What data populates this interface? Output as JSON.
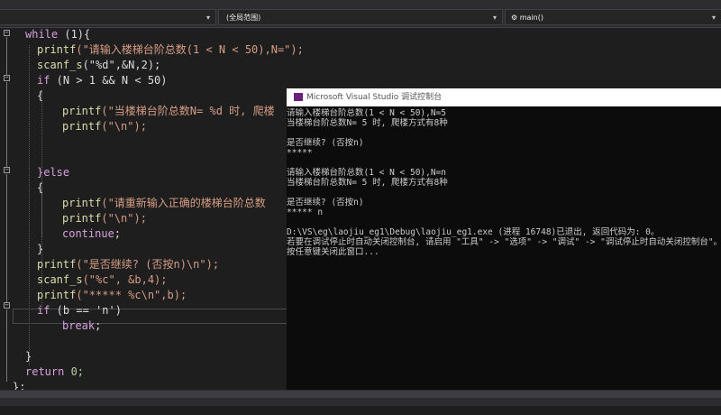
{
  "toolbar": {
    "scope_dropdown": "(全局范围)",
    "function_dropdown": "main()",
    "function_icon": "gear-icon"
  },
  "code_lines": [
    [
      "while",
      " (1){"
    ],
    [
      "printf",
      "(\"请输入楼梯台阶总数(1 < N < 50),N=\");"
    ],
    [
      "scanf_s",
      "(\"%d\",&N,2);"
    ],
    [
      "if",
      " (N > 1 && N < 50)"
    ],
    [
      "{",
      ""
    ],
    [
      "printf",
      "(\"当楼梯台阶总数N= %d 时, 爬楼"
    ],
    [
      "printf",
      "(\"\\n\");"
    ],
    [
      "}else",
      ""
    ],
    [
      "{",
      ""
    ],
    [
      "printf",
      "(\"请重新输入正确的楼梯台阶总数"
    ],
    [
      "printf",
      "(\"\\n\");"
    ],
    [
      "continue",
      ";"
    ],
    [
      "}",
      ""
    ],
    [
      "printf",
      "(\"是否继续? (否按n)\\n\");"
    ],
    [
      "scanf_s",
      "(\"%c\", &b,4);"
    ],
    [
      "printf",
      "(\"***** %c\\n\",b);"
    ],
    [
      "if",
      " (b == 'n')"
    ],
    [
      "break",
      ";"
    ],
    [
      "}",
      ""
    ],
    [
      "return",
      " 0;"
    ],
    [
      "}",
      ";"
    ]
  ],
  "console": {
    "title": "Microsoft Visual Studio 调试控制台",
    "lines": [
      "请输入楼梯台阶总数(1 < N < 50),N=5",
      "当楼梯台阶总数N= 5 时, 爬楼方式有8种",
      "",
      "是否继续? (否按n)",
      "*****",
      "",
      "请输入楼梯台阶总数(1 < N < 50),N=n",
      "当楼梯台阶总数N= 5 时, 爬楼方式有8种",
      "",
      "是否继续? (否按n)",
      "***** n",
      "",
      "D:\\VS\\eg\\laojiu_eg1\\Debug\\laojiu_eg1.exe (进程 16748)已退出, 返回代码为: 0。",
      "若要在调试停止时自动关闭控制台, 请启用 \"工具\" -> \"选项\" -> \"调试\" -> \"调试停止时自动关闭控制台\"。",
      "按任意键关闭此窗口..."
    ]
  }
}
